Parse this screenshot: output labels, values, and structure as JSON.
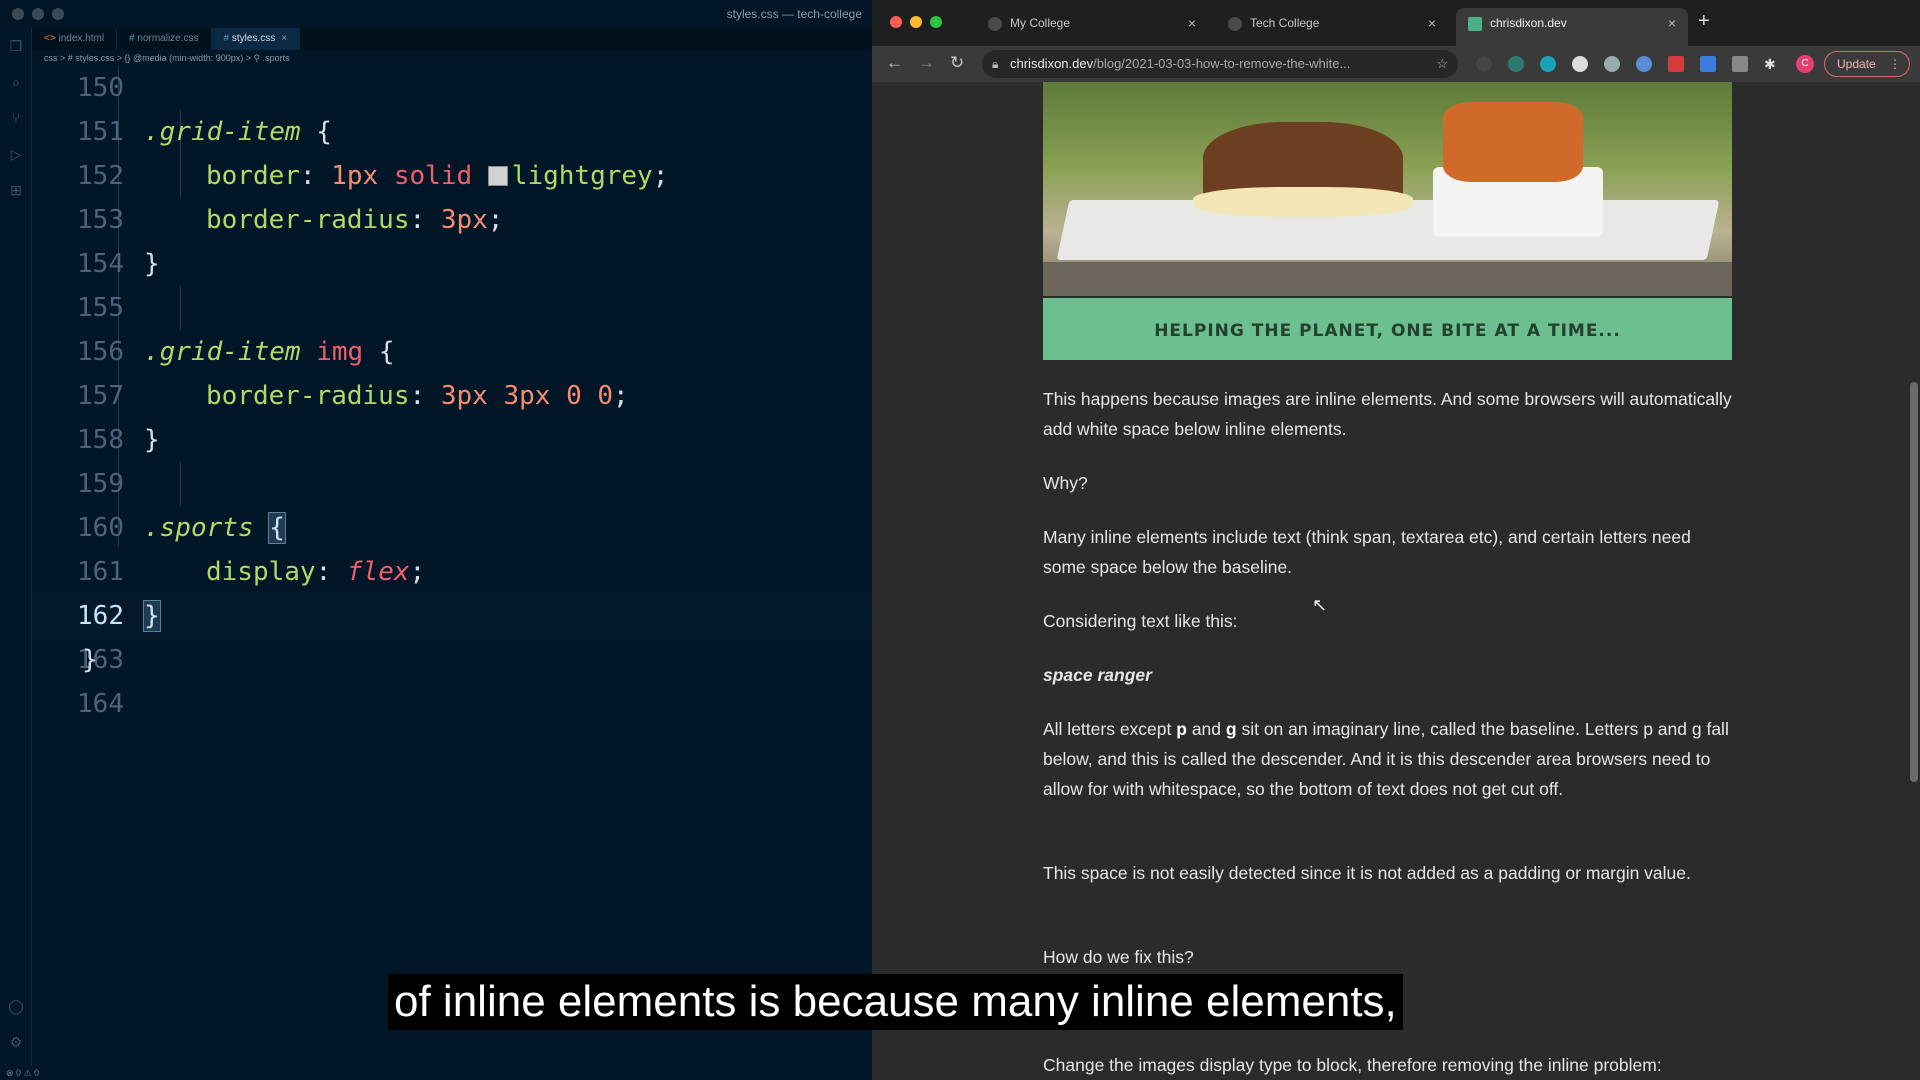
{
  "vscode": {
    "window_title": "styles.css — tech-college",
    "tabs": [
      {
        "label": "index.html",
        "icon": "html-icon"
      },
      {
        "label": "normalize.css",
        "icon": "css-icon"
      },
      {
        "label": "styles.css",
        "icon": "css-icon",
        "active": true,
        "close": "×"
      }
    ],
    "breadcrumb": "css > # styles.css > {} @media (min-width: 900px) > ⚲ .sports",
    "current_line": "162",
    "lines": [
      {
        "n": "150",
        "code": ""
      },
      {
        "n": "151",
        "tokens": [
          ".grid-item",
          " {"
        ]
      },
      {
        "n": "152",
        "tokens": [
          "border",
          ": ",
          "1px",
          " ",
          "solid",
          " ",
          "lightgrey",
          ";"
        ]
      },
      {
        "n": "153",
        "tokens": [
          "border-radius",
          ": ",
          "3px",
          ";"
        ]
      },
      {
        "n": "154",
        "tokens": [
          "}"
        ]
      },
      {
        "n": "155",
        "code": ""
      },
      {
        "n": "156",
        "tokens": [
          ".grid-item",
          " ",
          "img",
          " {"
        ]
      },
      {
        "n": "157",
        "tokens": [
          "border-radius",
          ": ",
          "3px",
          " ",
          "3px",
          " ",
          "0",
          " ",
          "0",
          ";"
        ]
      },
      {
        "n": "158",
        "tokens": [
          "}"
        ]
      },
      {
        "n": "159",
        "code": ""
      },
      {
        "n": "160",
        "tokens": [
          ".sports",
          " ",
          "{"
        ]
      },
      {
        "n": "161",
        "tokens": [
          "display",
          ": ",
          "flex",
          ";"
        ]
      },
      {
        "n": "162",
        "tokens": [
          "}"
        ]
      },
      {
        "n": "163",
        "tokens": [
          "}"
        ]
      },
      {
        "n": "164",
        "code": ""
      }
    ]
  },
  "browser": {
    "tabs": [
      {
        "label": "My College",
        "close": "×"
      },
      {
        "label": "Tech College",
        "close": "×"
      },
      {
        "label": "chrisdixon.dev",
        "close": "×",
        "active": true
      }
    ],
    "new_tab": "+",
    "nav": {
      "back": "←",
      "forward": "→",
      "reload": "↻"
    },
    "url_host": "chrisdixon.dev",
    "url_path": "/blog/2021-03-03-how-to-remove-the-white...",
    "update_label": "Update",
    "profile_initial": "C",
    "accent": "#6cc08f"
  },
  "article": {
    "caption": "HELPING THE PLANET, ONE BITE AT A TIME...",
    "p1": "This happens because images are inline elements. And some browsers will automatically add white space below inline elements.",
    "p2": "Why?",
    "p3": "Many inline elements include text (think span, textarea etc), and certain letters need some space below the baseline.",
    "p4": "Considering text like this:",
    "p5": "space ranger",
    "p6_a": "All letters except ",
    "p6_p": "p",
    "p6_b": " and ",
    "p6_g": "g",
    "p6_c": " sit on an imaginary line, called the baseline. Letters p and g fall below, and this is called the descender. And it is this descender area browsers need to allow for with whitespace, so the bottom of text does not get cut off.",
    "p7": "This space is not easily detected since it is not added as a padding or margin value.",
    "p8": "How do we fix this?",
    "p9": "Change the images display type to block, therefore removing the inline problem:"
  },
  "subtitle": "of inline elements is because many inline elements,"
}
